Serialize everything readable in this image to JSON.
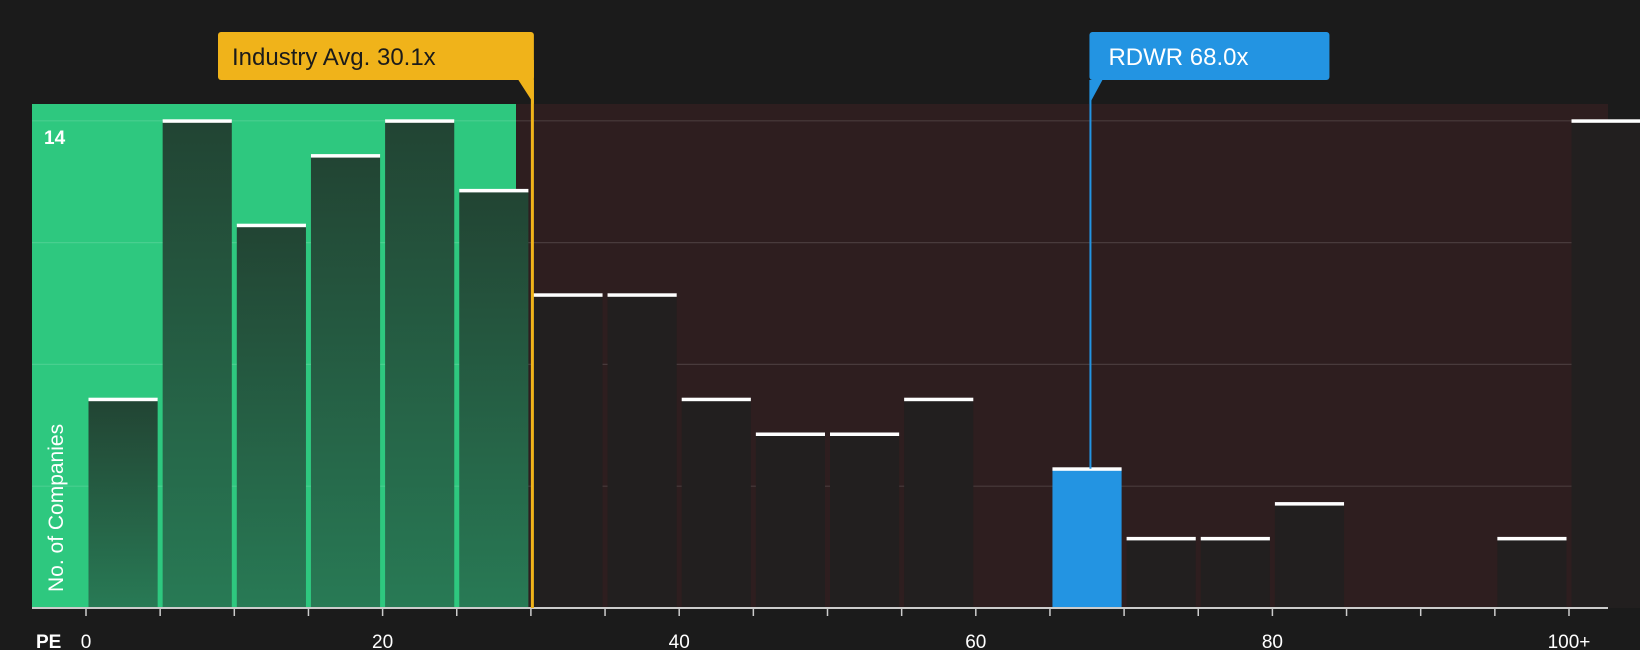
{
  "chart_data": {
    "type": "bar",
    "x_axis_prefix": "PE",
    "ylabel": "No. of Companies",
    "y_top_tick_label": "14",
    "ymax": 14,
    "x_ticks": [
      {
        "value": 0,
        "label": "0"
      },
      {
        "value": 20,
        "label": "20"
      },
      {
        "value": 40,
        "label": "40"
      },
      {
        "value": 60,
        "label": "60"
      },
      {
        "value": 80,
        "label": "80"
      },
      {
        "value": 100,
        "label": "100+"
      }
    ],
    "bins": [
      {
        "start": 0,
        "end": 5,
        "count": 6
      },
      {
        "start": 5,
        "end": 10,
        "count": 14
      },
      {
        "start": 10,
        "end": 15,
        "count": 11
      },
      {
        "start": 15,
        "end": 20,
        "count": 13
      },
      {
        "start": 20,
        "end": 25,
        "count": 14
      },
      {
        "start": 25,
        "end": 30,
        "count": 12
      },
      {
        "start": 30,
        "end": 35,
        "count": 9
      },
      {
        "start": 35,
        "end": 40,
        "count": 9
      },
      {
        "start": 40,
        "end": 45,
        "count": 6
      },
      {
        "start": 45,
        "end": 50,
        "count": 5
      },
      {
        "start": 50,
        "end": 55,
        "count": 5
      },
      {
        "start": 55,
        "end": 60,
        "count": 6
      },
      {
        "start": 60,
        "end": 65,
        "count": 0
      },
      {
        "start": 65,
        "end": 70,
        "count": 4
      },
      {
        "start": 70,
        "end": 75,
        "count": 2
      },
      {
        "start": 75,
        "end": 80,
        "count": 2
      },
      {
        "start": 80,
        "end": 85,
        "count": 3
      },
      {
        "start": 85,
        "end": 90,
        "count": 0
      },
      {
        "start": 90,
        "end": 95,
        "count": 0
      },
      {
        "start": 95,
        "end": 100,
        "count": 2
      },
      {
        "start": 100,
        "end": 105,
        "count": 14
      }
    ],
    "fair_range_end": 29,
    "industry_avg": {
      "value": 30.1,
      "label": "Industry Avg. 30.1x"
    },
    "company": {
      "ticker": "RDWR",
      "value": 68.0,
      "label": "RDWR 68.0x"
    },
    "colors": {
      "background": "#1b1b1b",
      "fair_zone": "#2ec87f",
      "over_zone": "#2e1e1f",
      "bar_in_fair": "#234a37",
      "bar_over": "#221f1f",
      "bar_company": "#2394e2",
      "industry_marker": "#f0b31a",
      "company_marker": "#2394e2",
      "axis": "#cccccc",
      "grid": "#444444",
      "text": "#ffffff"
    }
  }
}
